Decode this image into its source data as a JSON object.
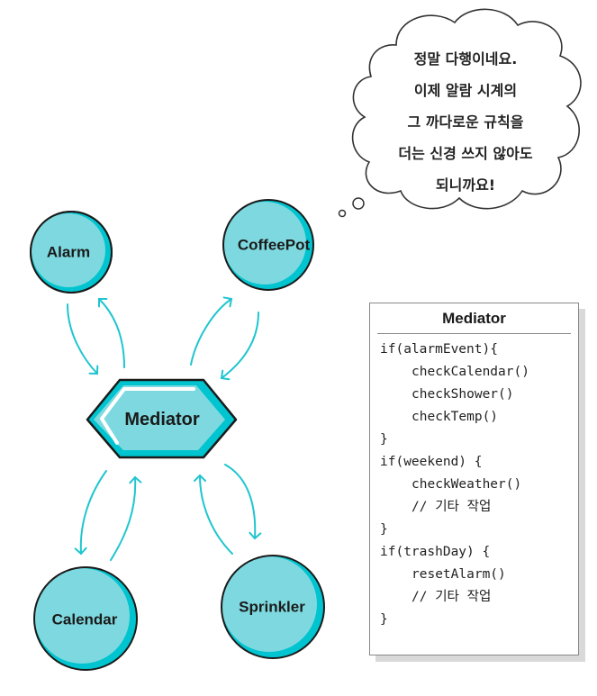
{
  "nodes": {
    "alarm": "Alarm",
    "coffeepot": "CoffeePot",
    "calendar": "Calendar",
    "sprinkler": "Sprinkler",
    "mediator": "Mediator"
  },
  "thought_bubble": {
    "lines": [
      "정말 다행이네요.",
      "이제 알람 시계의",
      "그 까다로운 규칙을",
      "더는 신경 쓰지 않아도",
      "되니까요!"
    ]
  },
  "code_box": {
    "title": "Mediator",
    "lines": [
      {
        "text": "if(alarmEvent){",
        "indent": false
      },
      {
        "text": "checkCalendar()",
        "indent": true
      },
      {
        "text": "checkShower()",
        "indent": true
      },
      {
        "text": "checkTemp()",
        "indent": true
      },
      {
        "text": "}",
        "indent": false
      },
      {
        "text": "if(weekend) {",
        "indent": false
      },
      {
        "text": "checkWeather()",
        "indent": true
      },
      {
        "text": "// 기타 작업",
        "indent": true
      },
      {
        "text": "}",
        "indent": false
      },
      {
        "text": "if(trashDay) {",
        "indent": false
      },
      {
        "text": "resetAlarm()",
        "indent": true
      },
      {
        "text": "// 기타 작업",
        "indent": true
      },
      {
        "text": "}",
        "indent": false
      }
    ]
  },
  "colors": {
    "node_fill": "#7dd9df",
    "node_shade": "#00c4cf",
    "arrow": "#1fc5cf",
    "outline": "#1a1a1a"
  }
}
